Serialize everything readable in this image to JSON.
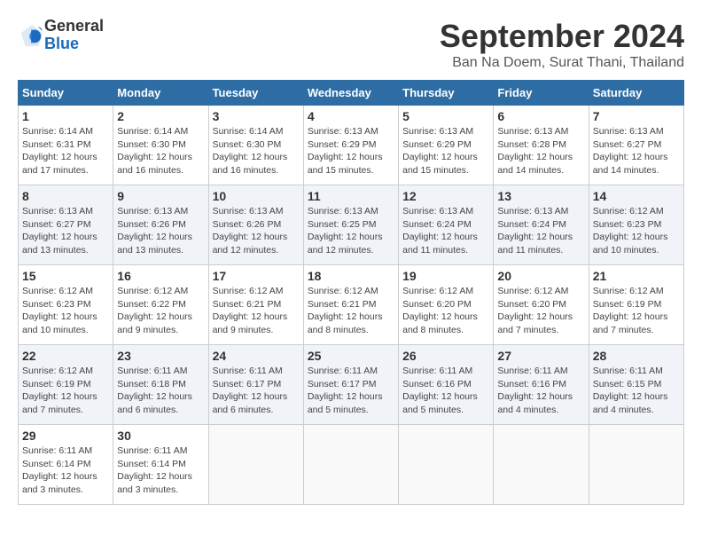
{
  "header": {
    "logo_general": "General",
    "logo_blue": "Blue",
    "month_title": "September 2024",
    "location": "Ban Na Doem, Surat Thani, Thailand"
  },
  "days_of_week": [
    "Sunday",
    "Monday",
    "Tuesday",
    "Wednesday",
    "Thursday",
    "Friday",
    "Saturday"
  ],
  "weeks": [
    [
      {
        "day": "1",
        "sunrise": "6:14 AM",
        "sunset": "6:31 PM",
        "daylight": "12 hours and 17 minutes."
      },
      {
        "day": "2",
        "sunrise": "6:14 AM",
        "sunset": "6:30 PM",
        "daylight": "12 hours and 16 minutes."
      },
      {
        "day": "3",
        "sunrise": "6:14 AM",
        "sunset": "6:30 PM",
        "daylight": "12 hours and 16 minutes."
      },
      {
        "day": "4",
        "sunrise": "6:13 AM",
        "sunset": "6:29 PM",
        "daylight": "12 hours and 15 minutes."
      },
      {
        "day": "5",
        "sunrise": "6:13 AM",
        "sunset": "6:29 PM",
        "daylight": "12 hours and 15 minutes."
      },
      {
        "day": "6",
        "sunrise": "6:13 AM",
        "sunset": "6:28 PM",
        "daylight": "12 hours and 14 minutes."
      },
      {
        "day": "7",
        "sunrise": "6:13 AM",
        "sunset": "6:27 PM",
        "daylight": "12 hours and 14 minutes."
      }
    ],
    [
      {
        "day": "8",
        "sunrise": "6:13 AM",
        "sunset": "6:27 PM",
        "daylight": "12 hours and 13 minutes."
      },
      {
        "day": "9",
        "sunrise": "6:13 AM",
        "sunset": "6:26 PM",
        "daylight": "12 hours and 13 minutes."
      },
      {
        "day": "10",
        "sunrise": "6:13 AM",
        "sunset": "6:26 PM",
        "daylight": "12 hours and 12 minutes."
      },
      {
        "day": "11",
        "sunrise": "6:13 AM",
        "sunset": "6:25 PM",
        "daylight": "12 hours and 12 minutes."
      },
      {
        "day": "12",
        "sunrise": "6:13 AM",
        "sunset": "6:24 PM",
        "daylight": "12 hours and 11 minutes."
      },
      {
        "day": "13",
        "sunrise": "6:13 AM",
        "sunset": "6:24 PM",
        "daylight": "12 hours and 11 minutes."
      },
      {
        "day": "14",
        "sunrise": "6:12 AM",
        "sunset": "6:23 PM",
        "daylight": "12 hours and 10 minutes."
      }
    ],
    [
      {
        "day": "15",
        "sunrise": "6:12 AM",
        "sunset": "6:23 PM",
        "daylight": "12 hours and 10 minutes."
      },
      {
        "day": "16",
        "sunrise": "6:12 AM",
        "sunset": "6:22 PM",
        "daylight": "12 hours and 9 minutes."
      },
      {
        "day": "17",
        "sunrise": "6:12 AM",
        "sunset": "6:21 PM",
        "daylight": "12 hours and 9 minutes."
      },
      {
        "day": "18",
        "sunrise": "6:12 AM",
        "sunset": "6:21 PM",
        "daylight": "12 hours and 8 minutes."
      },
      {
        "day": "19",
        "sunrise": "6:12 AM",
        "sunset": "6:20 PM",
        "daylight": "12 hours and 8 minutes."
      },
      {
        "day": "20",
        "sunrise": "6:12 AM",
        "sunset": "6:20 PM",
        "daylight": "12 hours and 7 minutes."
      },
      {
        "day": "21",
        "sunrise": "6:12 AM",
        "sunset": "6:19 PM",
        "daylight": "12 hours and 7 minutes."
      }
    ],
    [
      {
        "day": "22",
        "sunrise": "6:12 AM",
        "sunset": "6:19 PM",
        "daylight": "12 hours and 7 minutes."
      },
      {
        "day": "23",
        "sunrise": "6:11 AM",
        "sunset": "6:18 PM",
        "daylight": "12 hours and 6 minutes."
      },
      {
        "day": "24",
        "sunrise": "6:11 AM",
        "sunset": "6:17 PM",
        "daylight": "12 hours and 6 minutes."
      },
      {
        "day": "25",
        "sunrise": "6:11 AM",
        "sunset": "6:17 PM",
        "daylight": "12 hours and 5 minutes."
      },
      {
        "day": "26",
        "sunrise": "6:11 AM",
        "sunset": "6:16 PM",
        "daylight": "12 hours and 5 minutes."
      },
      {
        "day": "27",
        "sunrise": "6:11 AM",
        "sunset": "6:16 PM",
        "daylight": "12 hours and 4 minutes."
      },
      {
        "day": "28",
        "sunrise": "6:11 AM",
        "sunset": "6:15 PM",
        "daylight": "12 hours and 4 minutes."
      }
    ],
    [
      {
        "day": "29",
        "sunrise": "6:11 AM",
        "sunset": "6:14 PM",
        "daylight": "12 hours and 3 minutes."
      },
      {
        "day": "30",
        "sunrise": "6:11 AM",
        "sunset": "6:14 PM",
        "daylight": "12 hours and 3 minutes."
      },
      null,
      null,
      null,
      null,
      null
    ]
  ],
  "labels": {
    "sunrise_prefix": "Sunrise:",
    "sunset_prefix": "Sunset:",
    "daylight_prefix": "Daylight:"
  }
}
